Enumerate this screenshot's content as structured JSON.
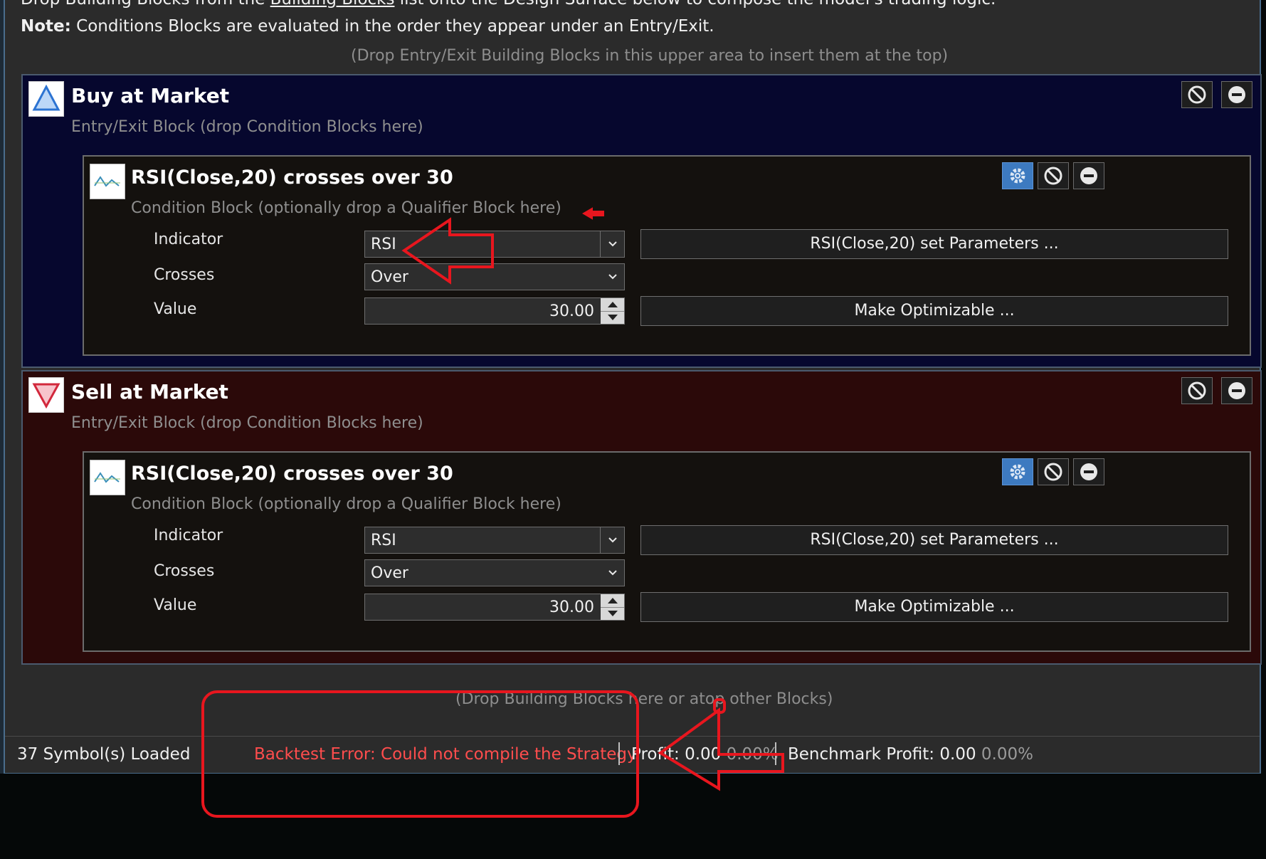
{
  "header": {
    "instruction_prefix": "Drop Building Blocks from the ",
    "instruction_link": "Building Blocks",
    "instruction_suffix": " list onto the Design Surface below to compose the model's trading logic.",
    "note_label": "Note:",
    "note_text": " Conditions Blocks are evaluated in the order they appear under an Entry/Exit.",
    "top_drop_hint": "(Drop Entry/Exit Building Blocks in this upper area to insert them at the top)"
  },
  "buy_block": {
    "title": "Buy at Market",
    "subtitle": "Entry/Exit Block (drop Condition Blocks here)",
    "condition": {
      "title": "RSI(Close,20) crosses over 30",
      "subtitle": "Condition Block (optionally drop a Qualifier Block here)",
      "indicator_label": "Indicator",
      "indicator_value": "RSI",
      "crosses_label": "Crosses",
      "crosses_value": "Over",
      "value_label": "Value",
      "value_value": "30.00",
      "params_button": "RSI(Close,20) set Parameters ...",
      "optimize_button": "Make Optimizable ..."
    }
  },
  "sell_block": {
    "title": "Sell at Market",
    "subtitle": "Entry/Exit Block (drop Condition Blocks here)",
    "condition": {
      "title": "RSI(Close,20) crosses over 30",
      "subtitle": "Condition Block (optionally drop a Qualifier Block here)",
      "indicator_label": "Indicator",
      "indicator_value": "RSI",
      "crosses_label": "Crosses",
      "crosses_value": "Over",
      "value_label": "Value",
      "value_value": "30.00",
      "params_button": "RSI(Close,20) set Parameters ...",
      "optimize_button": "Make Optimizable ..."
    }
  },
  "bottom_drop_hint": "(Drop Building Blocks here or atop other Blocks)",
  "status_bar": {
    "symbols_loaded": "37 Symbol(s) Loaded",
    "backtest_error": "Backtest Error: Could not compile the Strategy.",
    "profit_label": "Profit:",
    "profit_value": "0.00",
    "profit_pct": "0.00%",
    "benchmark_label": "Benchmark Profit:",
    "benchmark_value": "0.00",
    "benchmark_pct": "0.00%"
  },
  "colors": {
    "buy_background": "#06072e",
    "sell_background": "#2b0909",
    "error_text": "#ff4d4d",
    "annotation_red": "#e8161e",
    "gear_button": "#3d7ac0"
  },
  "icons": [
    "triangle-up-icon",
    "triangle-down-icon",
    "indicator-wave-icon",
    "gear-icon",
    "disable-icon",
    "remove-icon",
    "chevron-down-icon",
    "spinner-up-icon",
    "spinner-down-icon"
  ]
}
